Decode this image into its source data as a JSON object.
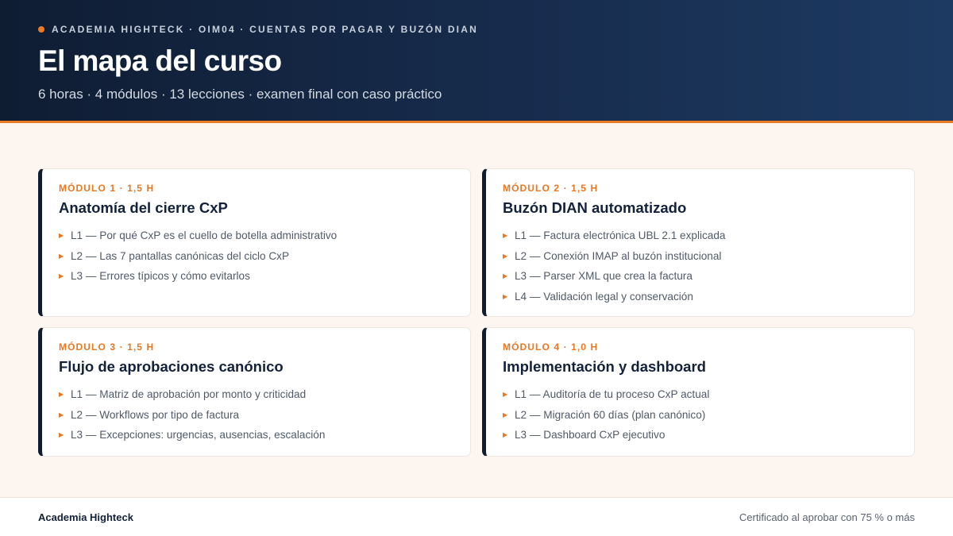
{
  "header": {
    "eyebrow": "ACADEMIA HIGHTECK · OIM04 · CUENTAS POR PAGAR Y BUZÓN DIAN",
    "title": "El mapa del curso",
    "subtitle": "6 horas · 4 módulos · 13 lecciones · examen final con caso práctico"
  },
  "modules": [
    {
      "label": "MÓDULO 1 · 1,5 H",
      "title": "Anatomía del cierre CxP",
      "lessons": [
        "L1 — Por qué CxP es el cuello de botella administrativo",
        "L2 — Las 7 pantallas canónicas del ciclo CxP",
        "L3 — Errores típicos y cómo evitarlos"
      ]
    },
    {
      "label": "MÓDULO 2 · 1,5 H",
      "title": "Buzón DIAN automatizado",
      "lessons": [
        "L1 — Factura electrónica UBL 2.1 explicada",
        "L2 — Conexión IMAP al buzón institucional",
        "L3 — Parser XML que crea la factura",
        "L4 — Validación legal y conservación"
      ]
    },
    {
      "label": "MÓDULO 3 · 1,5 H",
      "title": "Flujo de aprobaciones canónico",
      "lessons": [
        "L1 — Matriz de aprobación por monto y criticidad",
        "L2 — Workflows por tipo de factura",
        "L3 — Excepciones: urgencias, ausencias, escalación"
      ]
    },
    {
      "label": "MÓDULO 4 · 1,0 H",
      "title": "Implementación y dashboard",
      "lessons": [
        "L1 — Auditoría de tu proceso CxP actual",
        "L2 — Migración 60 días (plan canónico)",
        "L3 — Dashboard CxP ejecutivo"
      ]
    }
  ],
  "footer": {
    "brand": "Academia Highteck",
    "certificate": "Certificado al aprobar con 75 % o más"
  },
  "colors": {
    "accent": "#f07a22",
    "navy": "#0f1d33",
    "background": "#fdf6f0"
  },
  "icons": {
    "eyebrow_marker": "orange-dot-icon",
    "lesson_bullet": "triangle-right-icon"
  }
}
